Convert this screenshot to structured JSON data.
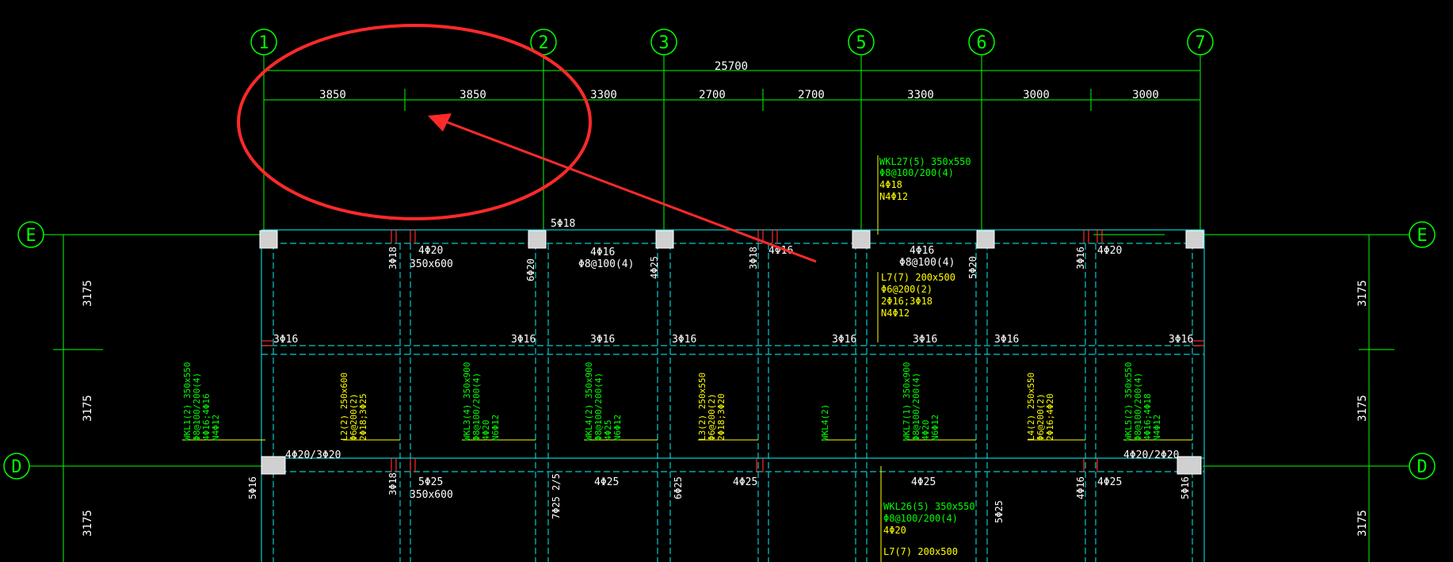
{
  "axes_top": [
    {
      "label": "1"
    },
    {
      "label": "2"
    },
    {
      "label": "3"
    },
    {
      "label": "5"
    },
    {
      "label": "6"
    },
    {
      "label": "7"
    }
  ],
  "axes_side": [
    {
      "label": "E"
    },
    {
      "label": "D"
    }
  ],
  "dimensions": {
    "overall": "25700",
    "spans": [
      "3850",
      "3850",
      "3300",
      "2700",
      "2700",
      "3300",
      "3000",
      "3000"
    ],
    "vertical": [
      "3175",
      "3175",
      "3175"
    ]
  },
  "beam_notes": {
    "wkl27": [
      "WKL27(5) 350x550",
      "Φ8@100/200(4)",
      "4Φ18",
      "N4Φ12"
    ],
    "l7_right": [
      "L7(7) 200x500",
      "Φ6@200(2)",
      "2Φ16;3Φ18",
      "N4Φ12"
    ],
    "wkl26": [
      "WKL26(5) 350x550",
      "Φ8@100/200(4)",
      "4Φ20"
    ],
    "l7_bottom": "L7(7) 200x500",
    "row1_above": [
      "5Φ18",
      "4Φ20",
      "350x600",
      "4Φ16",
      "Φ8@100(4)",
      "4Φ16",
      "4Φ16",
      "Φ8@100(4)",
      "4Φ20"
    ],
    "row1_side": [
      "3Φ18",
      "6Φ20",
      "4Φ25",
      "3Φ18",
      "5Φ20",
      "3Φ16"
    ],
    "mid_row": [
      "3Φ16",
      "3Φ16",
      "3Φ16",
      "3Φ16",
      "3Φ16",
      "3Φ16",
      "3Φ16",
      "3Φ16"
    ],
    "row2": [
      "4Φ20/3Φ20",
      "5Φ25",
      "350x600",
      "4Φ25",
      "4Φ25",
      "4Φ25",
      "4Φ25",
      "4Φ20/2Φ20"
    ],
    "row2_side": [
      "5Φ16",
      "3Φ18",
      "7Φ25 2/5",
      "6Φ25",
      "5Φ25",
      "4Φ16",
      "5Φ16"
    ]
  },
  "vertical_notes": [
    [
      "WKL1(2) 350x550",
      "Φ8@100/200(4)",
      "4Φ16;4Φ16",
      "N4Φ12"
    ],
    [
      "L2(2) 250x600",
      "Φ6@200(2)",
      "2Φ18;3Φ25"
    ],
    [
      "WKL3(4) 350x900",
      "Φ8@100/200(4)",
      "4Φ20",
      "N6Φ12"
    ],
    [
      "WKL4(2) 350x900",
      "Φ8@100/200(4)",
      "4Φ25",
      "N6Φ12"
    ],
    [
      "L3(2) 250x550",
      "Φ6@200(2)",
      "2Φ18;3Φ20"
    ],
    [
      "WKL4(2)"
    ],
    [
      "WKL7(1) 350x900",
      "Φ8@100/200(4)",
      "4Φ20",
      "N6Φ12"
    ],
    [
      "L4(2) 250x550",
      "Φ6@200(2)",
      "2Φ16;4Φ20"
    ],
    [
      "WKL5(2) 350x550",
      "Φ8@100/200(4)",
      "4Φ16;4Φ18",
      "N4Φ12"
    ]
  ],
  "colors": {
    "background": "#000000",
    "axis": "#00ff00",
    "beam": "#00cccc",
    "note_green": "#00ff00",
    "note_yellow": "#ffff00",
    "text_white": "#ffffff",
    "highlight": "#ff2a2a"
  }
}
